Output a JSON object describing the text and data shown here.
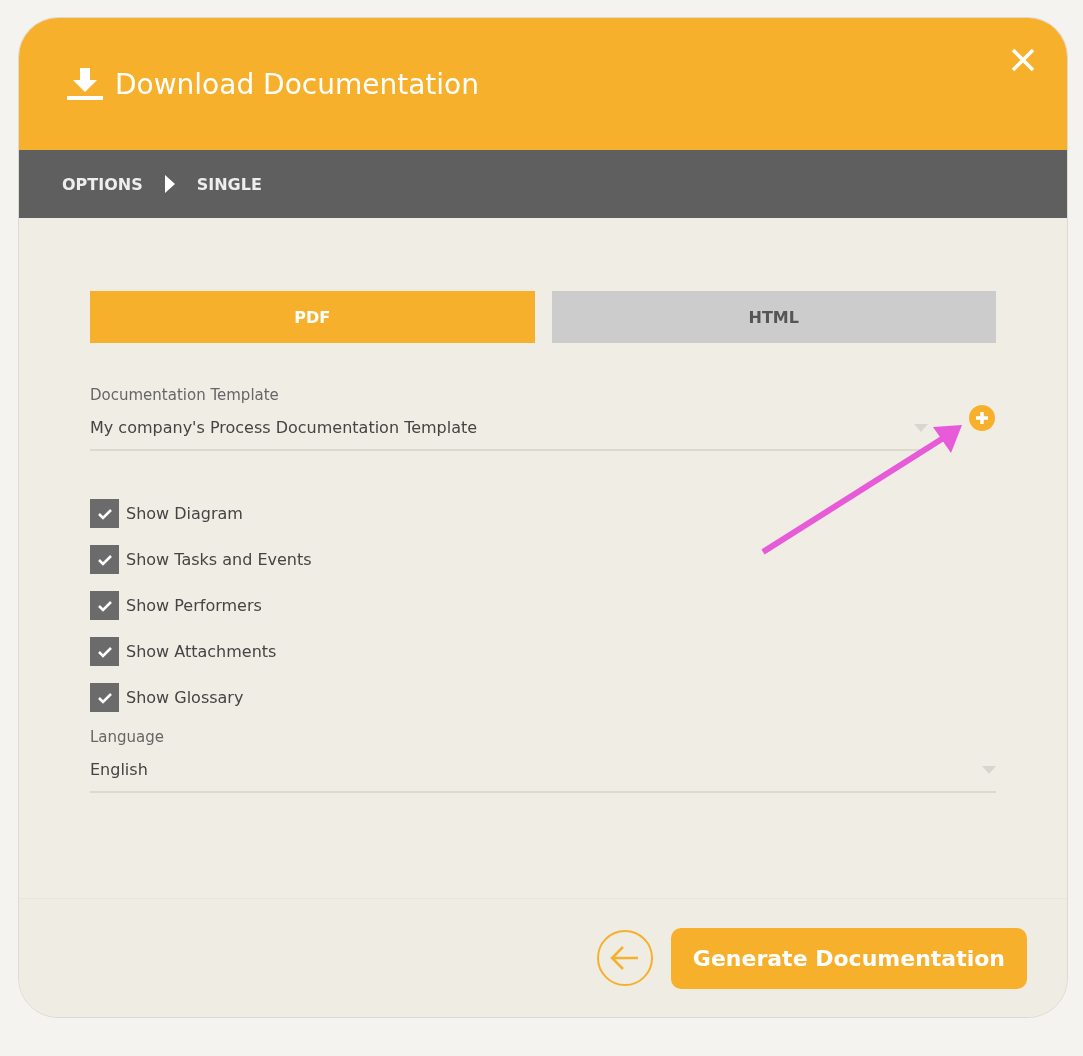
{
  "dialog": {
    "title": "Download Documentation"
  },
  "breadcrumb": [
    "OPTIONS",
    "SINGLE"
  ],
  "tabs": [
    {
      "label": "PDF",
      "selected": true
    },
    {
      "label": "HTML",
      "selected": false
    }
  ],
  "template": {
    "label": "Documentation Template",
    "value": "My company's Process Documentation Template"
  },
  "options": [
    {
      "label": "Show Diagram",
      "checked": true
    },
    {
      "label": "Show Tasks and Events",
      "checked": true
    },
    {
      "label": "Show Performers",
      "checked": true
    },
    {
      "label": "Show Attachments",
      "checked": true
    },
    {
      "label": "Show Glossary",
      "checked": true
    }
  ],
  "language": {
    "label": "Language",
    "value": "English"
  },
  "buttons": {
    "generate": "Generate Documentation"
  }
}
